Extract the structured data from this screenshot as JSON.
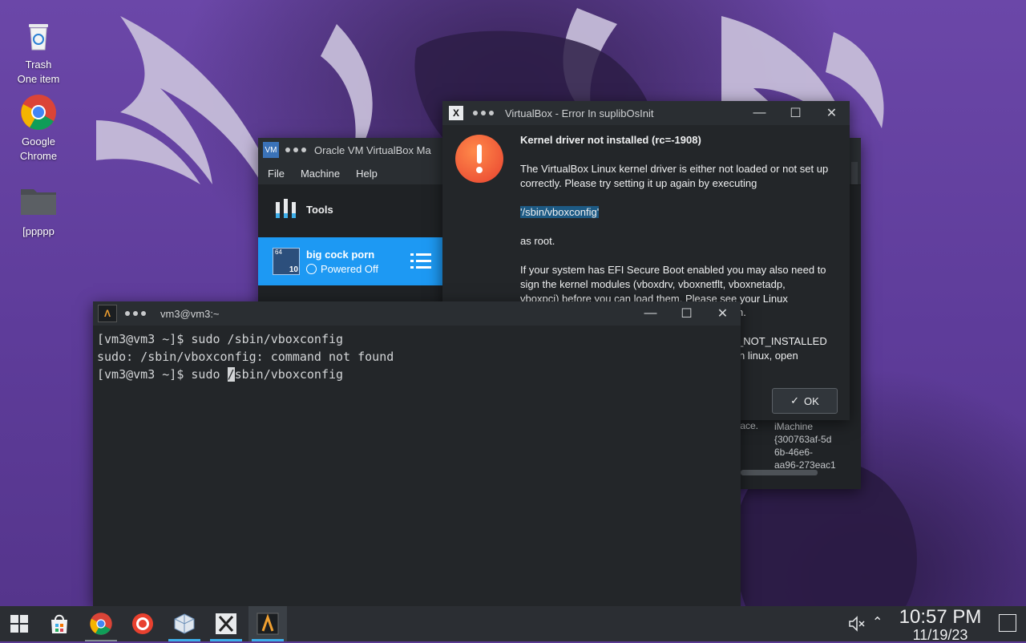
{
  "desktop": {
    "icons": [
      {
        "label": "Trash",
        "sublabel": "One item",
        "icon": "trash-icon"
      },
      {
        "label": "Google",
        "sublabel": "Chrome",
        "icon": "chrome-icon"
      },
      {
        "label": "[ppppp",
        "icon": "folder-icon"
      }
    ]
  },
  "vbox_manager": {
    "title": "Oracle VM VirtualBox Ma",
    "menu": [
      "File",
      "Machine",
      "Help"
    ],
    "tools_label": "Tools",
    "vm": {
      "name": "big cock porn",
      "state": "Powered Off",
      "badge": "64",
      "badge2": "10"
    },
    "detail_label": "face.",
    "detail_value": [
      "iMachine",
      "{300763af-5d",
      "6b-46e6-",
      "aa96-273eac1"
    ]
  },
  "error_dialog": {
    "title": "VirtualBox - Error In suplibOsInit",
    "heading": "Kernel driver not installed (rc=-1908)",
    "para1": "The VirtualBox Linux kernel driver is either not loaded or not set up correctly. Please try setting it up again by executing",
    "command": "'/sbin/vboxconfig'",
    "para2": "as root.",
    "para3_line1": "If your system has EFI Secure Boot enabled you may also need to",
    "para3_line2": "sign the kernel modules (vboxdrv, vboxnetflt, vboxnetadp,",
    "para3_line3": "vboxpci) before you can load them. Please see your Linux",
    "para3_line4": "n.",
    "frag1": "_NOT_INSTALLED",
    "frag2": "n linux, open",
    "ok_label": "OK"
  },
  "terminal": {
    "title": "vm3@vm3:~",
    "lines": [
      "[vm3@vm3 ~]$ sudo /sbin/vboxconfig",
      "sudo: /sbin/vboxconfig: command not found"
    ],
    "current_prompt": "[vm3@vm3 ~]$ sudo ",
    "cursor_char": "/",
    "current_rest": "sbin/vboxconfig"
  },
  "taskbar": {
    "apps": [
      "start-menu",
      "discover",
      "chrome",
      "screen-recorder",
      "virtualbox",
      "xorg",
      "terminal"
    ],
    "clock_time": "10:57 PM",
    "clock_date": "11/19/23"
  },
  "colors": {
    "accent": "#3daee9",
    "selection": "#1d99f3",
    "error_red": "#e8412f"
  }
}
